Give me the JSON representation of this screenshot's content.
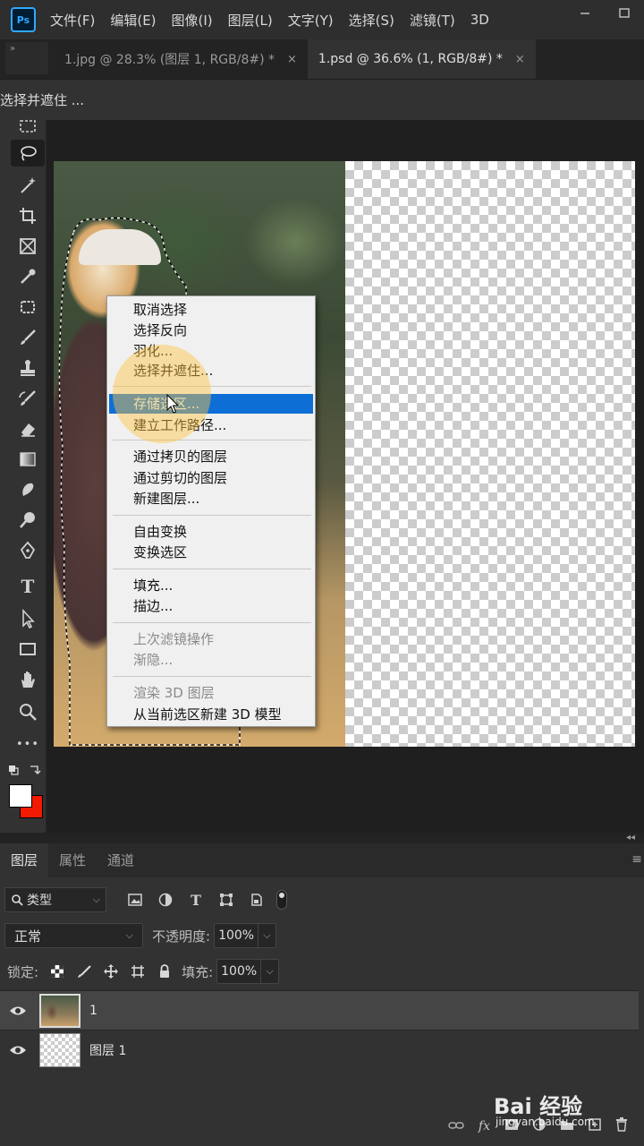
{
  "app": {
    "logo_text": "Ps"
  },
  "menubar": {
    "items": [
      "文件(F)",
      "编辑(E)",
      "图像(I)",
      "图层(L)",
      "文字(Y)",
      "选择(S)",
      "滤镜(T)",
      "3D"
    ]
  },
  "tabs": [
    {
      "label": "1.jpg @ 28.3% (图层 1, RGB/8#) *",
      "close": "×"
    },
    {
      "label": "1.psd @ 36.6% (1, RGB/8#) *",
      "close": "×"
    }
  ],
  "options": {
    "refine_label": "选择并遮住 ..."
  },
  "toolbar": {
    "type_tool_glyph": "T",
    "more_tools": "•••"
  },
  "context_menu": {
    "groups": [
      [
        "取消选择",
        "选择反向",
        "羽化...",
        "选择并遮住..."
      ],
      [
        "存储选区...",
        "建立工作路径..."
      ],
      [
        "通过拷贝的图层",
        "通过剪切的图层",
        "新建图层..."
      ],
      [
        "自由变换",
        "变换选区"
      ],
      [
        "填充...",
        "描边..."
      ],
      [
        "上次滤镜操作",
        "渐隐..."
      ],
      [
        "渲染 3D 图层",
        "从当前选区新建 3D 模型"
      ]
    ],
    "highlighted": "存储选区...",
    "disabled": [
      "上次滤镜操作",
      "渐隐...",
      "渲染 3D 图层"
    ]
  },
  "layers_panel": {
    "tabs": [
      "图层",
      "属性",
      "通道"
    ],
    "filter_label": "类型",
    "blend_mode": "正常",
    "opacity_label": "不透明度:",
    "opacity_value": "100%",
    "lock_label": "锁定:",
    "fill_label": "填充:",
    "fill_value": "100%",
    "layers": [
      {
        "name": "1",
        "selected": true
      },
      {
        "name": "图层 1",
        "selected": false
      }
    ],
    "footer_fx": "fx"
  },
  "colors": {
    "foreground": "#ffffff",
    "background": "#f21a00",
    "highlight": "#0d6fd6"
  },
  "watermark": {
    "brand": "Bai 经验",
    "url": "jingyan.baidu.com"
  }
}
